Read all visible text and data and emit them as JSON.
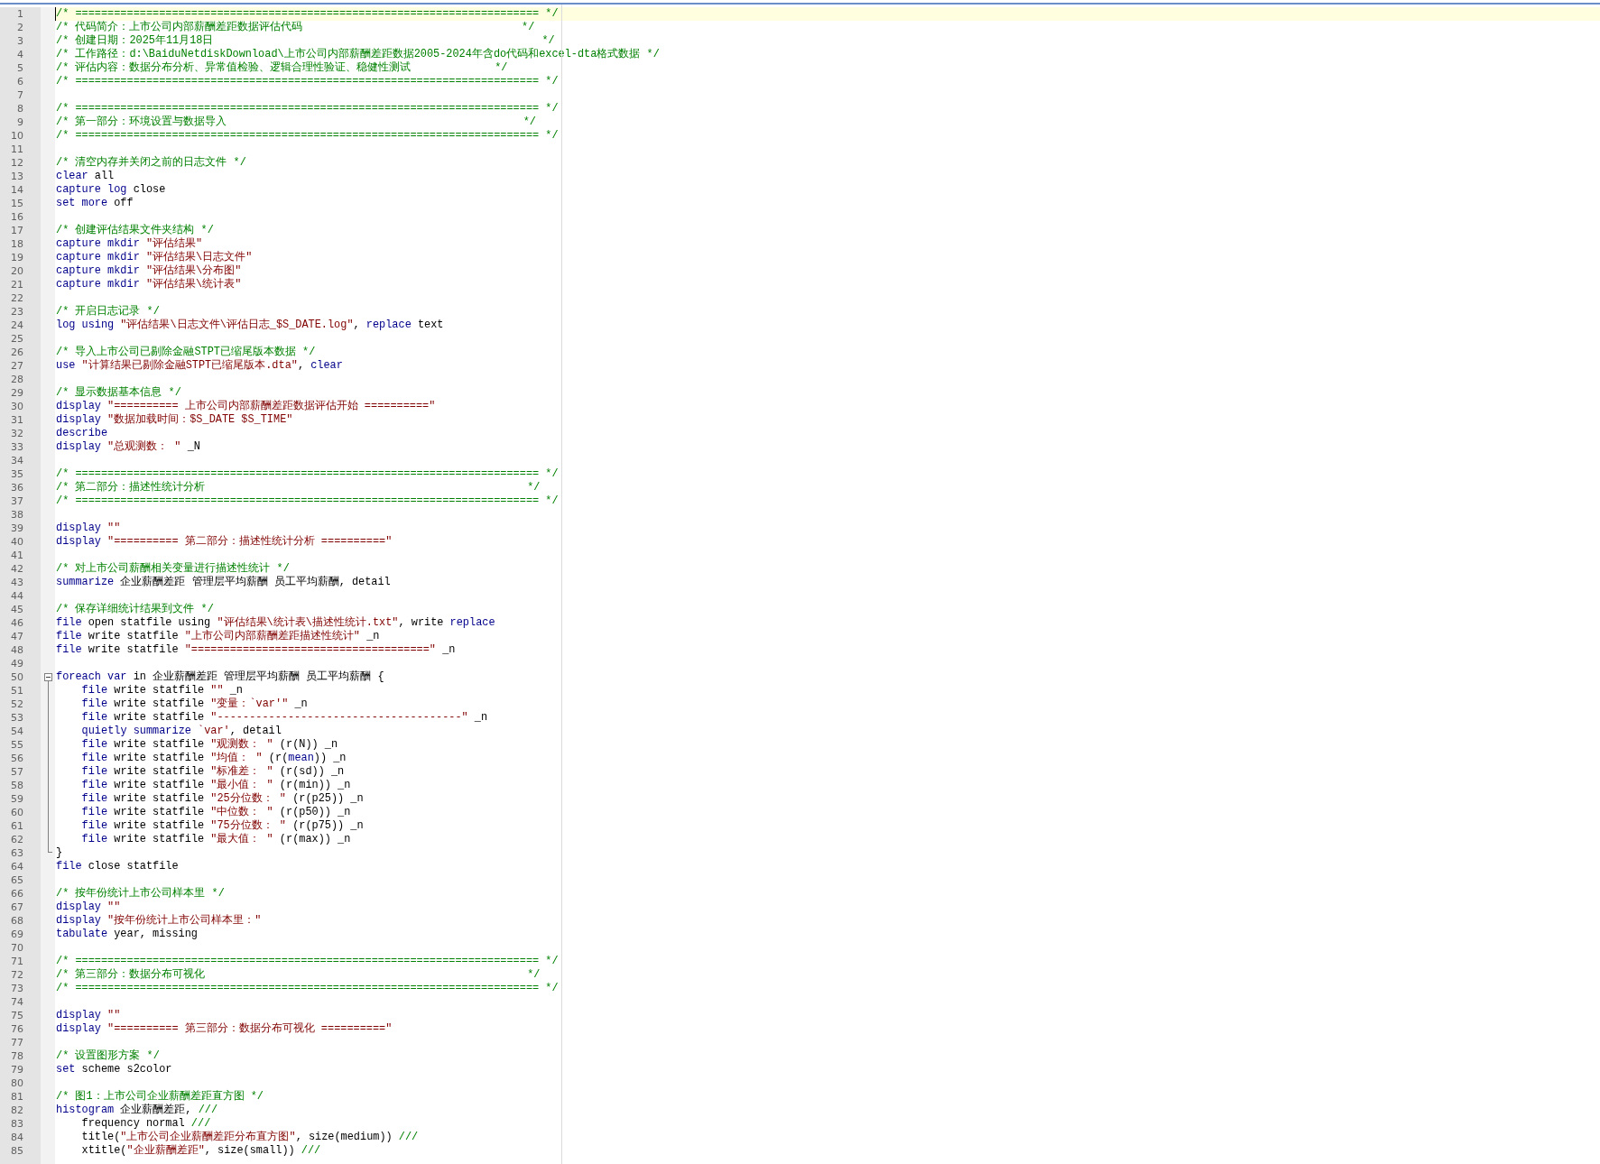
{
  "lines": [
    {
      "number": "1",
      "current": true,
      "segments": [
        {
          "kind": "comment",
          "text": "/* ======================================================================== */"
        }
      ]
    },
    {
      "number": "2",
      "current": false,
      "segments": [
        {
          "kind": "comment",
          "text": "/* 代码简介：上市公司内部薪酬差距数据评估代码                                  */"
        }
      ]
    },
    {
      "number": "3",
      "current": false,
      "segments": [
        {
          "kind": "comment",
          "text": "/* 创建日期：2025年11月18日                                                   */"
        }
      ]
    },
    {
      "number": "4",
      "current": false,
      "segments": [
        {
          "kind": "comment",
          "text": "/* 工作路径：d:\\BaiduNetdiskDownload\\上市公司内部薪酬差距数据2005-2024年含do代码和excel-dta格式数据 */"
        }
      ]
    },
    {
      "number": "5",
      "current": false,
      "segments": [
        {
          "kind": "comment",
          "text": "/* 评估内容：数据分布分析、异常值检验、逻辑合理性验证、稳健性测试             */"
        }
      ]
    },
    {
      "number": "6",
      "current": false,
      "segments": [
        {
          "kind": "comment",
          "text": "/* ======================================================================== */"
        }
      ]
    },
    {
      "number": "7",
      "current": false
    },
    {
      "number": "8",
      "current": false,
      "segments": [
        {
          "kind": "comment",
          "text": "/* ======================================================================== */"
        }
      ]
    },
    {
      "number": "9",
      "current": false,
      "segments": [
        {
          "kind": "comment",
          "text": "/* 第一部分：环境设置与数据导入                                              */"
        }
      ]
    },
    {
      "number": "10",
      "current": false,
      "segments": [
        {
          "kind": "comment",
          "text": "/* ======================================================================== */"
        }
      ]
    },
    {
      "number": "11",
      "current": false
    },
    {
      "number": "12",
      "current": false,
      "segments": [
        {
          "kind": "comment",
          "text": "/* 清空内存并关闭之前的日志文件 */"
        }
      ]
    },
    {
      "number": "13",
      "current": false,
      "segments": [
        {
          "kind": "keyword",
          "text": "clear"
        },
        {
          "kind": "plain",
          "text": " all"
        }
      ]
    },
    {
      "number": "14",
      "current": false,
      "segments": [
        {
          "kind": "keyword",
          "text": "capture log"
        },
        {
          "kind": "plain",
          "text": " close"
        }
      ]
    },
    {
      "number": "15",
      "current": false,
      "segments": [
        {
          "kind": "keyword",
          "text": "set more"
        },
        {
          "kind": "plain",
          "text": " off"
        }
      ]
    },
    {
      "number": "16",
      "current": false
    },
    {
      "number": "17",
      "current": false,
      "segments": [
        {
          "kind": "comment",
          "text": "/* 创建评估结果文件夹结构 */"
        }
      ]
    },
    {
      "number": "18",
      "current": false,
      "segments": [
        {
          "kind": "keyword",
          "text": "capture mkdir "
        },
        {
          "kind": "string",
          "text": "\"评估结果\""
        }
      ]
    },
    {
      "number": "19",
      "current": false,
      "segments": [
        {
          "kind": "keyword",
          "text": "capture mkdir "
        },
        {
          "kind": "string",
          "text": "\"评估结果\\日志文件\""
        }
      ]
    },
    {
      "number": "20",
      "current": false,
      "segments": [
        {
          "kind": "keyword",
          "text": "capture mkdir "
        },
        {
          "kind": "string",
          "text": "\"评估结果\\分布图\""
        }
      ]
    },
    {
      "number": "21",
      "current": false,
      "segments": [
        {
          "kind": "keyword",
          "text": "capture mkdir "
        },
        {
          "kind": "string",
          "text": "\"评估结果\\统计表\""
        }
      ]
    },
    {
      "number": "22",
      "current": false
    },
    {
      "number": "23",
      "current": false,
      "segments": [
        {
          "kind": "comment",
          "text": "/* 开启日志记录 */"
        }
      ]
    },
    {
      "number": "24",
      "current": false,
      "segments": [
        {
          "kind": "keyword",
          "text": "log using "
        },
        {
          "kind": "string",
          "text": "\"评估结果\\日志文件\\评估日志_$S_DATE.log\""
        },
        {
          "kind": "plain",
          "text": ", "
        },
        {
          "kind": "keyword",
          "text": "replace"
        },
        {
          "kind": "plain",
          "text": " text"
        }
      ]
    },
    {
      "number": "25",
      "current": false
    },
    {
      "number": "26",
      "current": false,
      "segments": [
        {
          "kind": "comment",
          "text": "/* 导入上市公司已剔除金融STPT已缩尾版本数据 */"
        }
      ]
    },
    {
      "number": "27",
      "current": false,
      "segments": [
        {
          "kind": "keyword",
          "text": "use "
        },
        {
          "kind": "string",
          "text": "\"计算结果已剔除金融STPT已缩尾版本.dta\""
        },
        {
          "kind": "plain",
          "text": ", "
        },
        {
          "kind": "keyword",
          "text": "clear"
        }
      ]
    },
    {
      "number": "28",
      "current": false
    },
    {
      "number": "29",
      "current": false,
      "segments": [
        {
          "kind": "comment",
          "text": "/* 显示数据基本信息 */"
        }
      ]
    },
    {
      "number": "30",
      "current": false,
      "segments": [
        {
          "kind": "keyword",
          "text": "display "
        },
        {
          "kind": "string",
          "text": "\"========== 上市公司内部薪酬差距数据评估开始 ==========\""
        }
      ]
    },
    {
      "number": "31",
      "current": false,
      "segments": [
        {
          "kind": "keyword",
          "text": "display "
        },
        {
          "kind": "string",
          "text": "\"数据加载时间：$S_DATE $S_TIME\""
        }
      ]
    },
    {
      "number": "32",
      "current": false,
      "segments": [
        {
          "kind": "keyword",
          "text": "describe"
        }
      ]
    },
    {
      "number": "33",
      "current": false,
      "segments": [
        {
          "kind": "keyword",
          "text": "display "
        },
        {
          "kind": "string",
          "text": "\"总观测数： \""
        },
        {
          "kind": "plain",
          "text": " _N"
        }
      ]
    },
    {
      "number": "34",
      "current": false
    },
    {
      "number": "35",
      "current": false,
      "segments": [
        {
          "kind": "comment",
          "text": "/* ======================================================================== */"
        }
      ]
    },
    {
      "number": "36",
      "current": false,
      "segments": [
        {
          "kind": "comment",
          "text": "/* 第二部分：描述性统计分析                                                  */"
        }
      ]
    },
    {
      "number": "37",
      "current": false,
      "segments": [
        {
          "kind": "comment",
          "text": "/* ======================================================================== */"
        }
      ]
    },
    {
      "number": "38",
      "current": false
    },
    {
      "number": "39",
      "current": false,
      "segments": [
        {
          "kind": "keyword",
          "text": "display "
        },
        {
          "kind": "string",
          "text": "\"\""
        }
      ]
    },
    {
      "number": "40",
      "current": false,
      "segments": [
        {
          "kind": "keyword",
          "text": "display "
        },
        {
          "kind": "string",
          "text": "\"========== 第二部分：描述性统计分析 ==========\""
        }
      ]
    },
    {
      "number": "41",
      "current": false
    },
    {
      "number": "42",
      "current": false,
      "segments": [
        {
          "kind": "comment",
          "text": "/* 对上市公司薪酬相关变量进行描述性统计 */"
        }
      ]
    },
    {
      "number": "43",
      "current": false,
      "segments": [
        {
          "kind": "keyword",
          "text": "summarize"
        },
        {
          "kind": "plain",
          "text": " 企业薪酬差距 管理层平均薪酬 员工平均薪酬, detail"
        }
      ]
    },
    {
      "number": "44",
      "current": false
    },
    {
      "number": "45",
      "current": false,
      "segments": [
        {
          "kind": "comment",
          "text": "/* 保存详细统计结果到文件 */"
        }
      ]
    },
    {
      "number": "46",
      "current": false,
      "segments": [
        {
          "kind": "keyword",
          "text": "file"
        },
        {
          "kind": "plain",
          "text": " open statfile using "
        },
        {
          "kind": "string",
          "text": "\"评估结果\\统计表\\描述性统计.txt\""
        },
        {
          "kind": "plain",
          "text": ", write "
        },
        {
          "kind": "keyword",
          "text": "replace"
        }
      ]
    },
    {
      "number": "47",
      "current": false,
      "segments": [
        {
          "kind": "keyword",
          "text": "file"
        },
        {
          "kind": "plain",
          "text": " write statfile "
        },
        {
          "kind": "string",
          "text": "\"上市公司内部薪酬差距描述性统计\""
        },
        {
          "kind": "plain",
          "text": " _n"
        }
      ]
    },
    {
      "number": "48",
      "current": false,
      "segments": [
        {
          "kind": "keyword",
          "text": "file"
        },
        {
          "kind": "plain",
          "text": " write statfile "
        },
        {
          "kind": "string",
          "text": "\"=====================================\""
        },
        {
          "kind": "plain",
          "text": " _n"
        }
      ]
    },
    {
      "number": "49",
      "current": false
    },
    {
      "number": "50",
      "current": false,
      "expanded": true,
      "segments": [
        {
          "kind": "keyword",
          "text": "foreach var"
        },
        {
          "kind": "plain",
          "text": " in 企业薪酬差距 管理层平均薪酬 员工平均薪酬 {"
        }
      ],
      "children": [
        {
          "number": "51",
          "current": false,
          "segments": [
            {
              "kind": "keyword",
              "text": "file"
            },
            {
              "kind": "plain",
              "text": " write statfile "
            },
            {
              "kind": "string",
              "text": "\"\""
            },
            {
              "kind": "plain",
              "text": " _n"
            }
          ]
        },
        {
          "number": "52",
          "current": false,
          "segments": [
            {
              "kind": "keyword",
              "text": "file"
            },
            {
              "kind": "plain",
              "text": " write statfile "
            },
            {
              "kind": "string",
              "text": "\"变量：`var'\""
            },
            {
              "kind": "plain",
              "text": " _n"
            }
          ]
        },
        {
          "number": "53",
          "current": false,
          "segments": [
            {
              "kind": "keyword",
              "text": "file"
            },
            {
              "kind": "plain",
              "text": " write statfile "
            },
            {
              "kind": "string",
              "text": "\"--------------------------------------\""
            },
            {
              "kind": "plain",
              "text": " _n"
            }
          ]
        },
        {
          "number": "54",
          "current": false,
          "segments": [
            {
              "kind": "keyword",
              "text": "quietly summarize "
            },
            {
              "kind": "string",
              "text": "`var'"
            },
            {
              "kind": "plain",
              "text": ", detail"
            }
          ]
        },
        {
          "number": "55",
          "current": false,
          "segments": [
            {
              "kind": "keyword",
              "text": "file"
            },
            {
              "kind": "plain",
              "text": " write statfile "
            },
            {
              "kind": "string",
              "text": "\"观测数： \""
            },
            {
              "kind": "plain",
              "text": " (r(N)) _n"
            }
          ]
        },
        {
          "number": "56",
          "current": false,
          "segments": [
            {
              "kind": "keyword",
              "text": "file"
            },
            {
              "kind": "plain",
              "text": " write statfile "
            },
            {
              "kind": "string",
              "text": "\"均值： \""
            },
            {
              "kind": "plain",
              "text": " (r("
            },
            {
              "kind": "keyword",
              "text": "mean"
            },
            {
              "kind": "plain",
              "text": ")) _n"
            }
          ]
        },
        {
          "number": "57",
          "current": false,
          "segments": [
            {
              "kind": "keyword",
              "text": "file"
            },
            {
              "kind": "plain",
              "text": " write statfile "
            },
            {
              "kind": "string",
              "text": "\"标准差： \""
            },
            {
              "kind": "plain",
              "text": " (r(sd)) _n"
            }
          ]
        },
        {
          "number": "58",
          "current": false,
          "segments": [
            {
              "kind": "keyword",
              "text": "file"
            },
            {
              "kind": "plain",
              "text": " write statfile "
            },
            {
              "kind": "string",
              "text": "\"最小值： \""
            },
            {
              "kind": "plain",
              "text": " (r(min)) _n"
            }
          ]
        },
        {
          "number": "59",
          "current": false,
          "segments": [
            {
              "kind": "keyword",
              "text": "file"
            },
            {
              "kind": "plain",
              "text": " write statfile "
            },
            {
              "kind": "string",
              "text": "\"25分位数： \""
            },
            {
              "kind": "plain",
              "text": " (r(p25)) _n"
            }
          ]
        },
        {
          "number": "60",
          "current": false,
          "segments": [
            {
              "kind": "keyword",
              "text": "file"
            },
            {
              "kind": "plain",
              "text": " write statfile "
            },
            {
              "kind": "string",
              "text": "\"中位数： \""
            },
            {
              "kind": "plain",
              "text": " (r(p50)) _n"
            }
          ]
        },
        {
          "number": "61",
          "current": false,
          "segments": [
            {
              "kind": "keyword",
              "text": "file"
            },
            {
              "kind": "plain",
              "text": " write statfile "
            },
            {
              "kind": "string",
              "text": "\"75分位数： \""
            },
            {
              "kind": "plain",
              "text": " (r(p75)) _n"
            }
          ]
        },
        {
          "number": "62",
          "current": false,
          "segments": [
            {
              "kind": "keyword",
              "text": "file"
            },
            {
              "kind": "plain",
              "text": " write statfile "
            },
            {
              "kind": "string",
              "text": "\"最大值： \""
            },
            {
              "kind": "plain",
              "text": " (r(max)) _n"
            }
          ]
        }
      ]
    },
    {
      "number": "63",
      "current": false,
      "segments": [
        {
          "kind": "plain",
          "text": "}"
        }
      ]
    },
    {
      "number": "64",
      "current": false,
      "segments": [
        {
          "kind": "keyword",
          "text": "file"
        },
        {
          "kind": "plain",
          "text": " close statfile"
        }
      ]
    },
    {
      "number": "65",
      "current": false
    },
    {
      "number": "66",
      "current": false,
      "segments": [
        {
          "kind": "comment",
          "text": "/* 按年份统计上市公司样本里 */"
        }
      ]
    },
    {
      "number": "67",
      "current": false,
      "segments": [
        {
          "kind": "keyword",
          "text": "display "
        },
        {
          "kind": "string",
          "text": "\"\""
        }
      ]
    },
    {
      "number": "68",
      "current": false,
      "segments": [
        {
          "kind": "keyword",
          "text": "display "
        },
        {
          "kind": "string",
          "text": "\"按年份统计上市公司样本里：\""
        }
      ]
    },
    {
      "number": "69",
      "current": false,
      "segments": [
        {
          "kind": "keyword",
          "text": "tabulate"
        },
        {
          "kind": "plain",
          "text": " year, missing"
        }
      ]
    },
    {
      "number": "70",
      "current": false
    },
    {
      "number": "71",
      "current": false,
      "segments": [
        {
          "kind": "comment",
          "text": "/* ======================================================================== */"
        }
      ]
    },
    {
      "number": "72",
      "current": false,
      "segments": [
        {
          "kind": "comment",
          "text": "/* 第三部分：数据分布可视化                                                  */"
        }
      ]
    },
    {
      "number": "73",
      "current": false,
      "segments": [
        {
          "kind": "comment",
          "text": "/* ======================================================================== */"
        }
      ]
    },
    {
      "number": "74",
      "current": false
    },
    {
      "number": "75",
      "current": false,
      "segments": [
        {
          "kind": "keyword",
          "text": "display "
        },
        {
          "kind": "string",
          "text": "\"\""
        }
      ]
    },
    {
      "number": "76",
      "current": false,
      "segments": [
        {
          "kind": "keyword",
          "text": "display "
        },
        {
          "kind": "string",
          "text": "\"========== 第三部分：数据分布可视化 ==========\""
        }
      ]
    },
    {
      "number": "77",
      "current": false
    },
    {
      "number": "78",
      "current": false,
      "segments": [
        {
          "kind": "comment",
          "text": "/* 设置图形方案 */"
        }
      ]
    },
    {
      "number": "79",
      "current": false,
      "segments": [
        {
          "kind": "keyword",
          "text": "set"
        },
        {
          "kind": "plain",
          "text": " scheme s2color"
        }
      ]
    },
    {
      "number": "80",
      "current": false
    },
    {
      "number": "81",
      "current": false,
      "segments": [
        {
          "kind": "comment",
          "text": "/* 图1：上市公司企业薪酬差距直方图 */"
        }
      ]
    },
    {
      "number": "82",
      "current": false,
      "segments": [
        {
          "kind": "keyword",
          "text": "histogram"
        },
        {
          "kind": "plain",
          "text": " 企业薪酬差距, "
        },
        {
          "kind": "comment",
          "text": "///"
        }
      ]
    },
    {
      "number": "83",
      "current": false,
      "segments": [
        {
          "kind": "plain",
          "text": "    frequency normal "
        },
        {
          "kind": "comment",
          "text": "///"
        }
      ]
    },
    {
      "number": "84",
      "current": false,
      "segments": [
        {
          "kind": "plain",
          "text": "    title("
        },
        {
          "kind": "string",
          "text": "\"上市公司企业薪酬差距分布直方图\""
        },
        {
          "kind": "plain",
          "text": ", size(medium)) "
        },
        {
          "kind": "comment",
          "text": "///"
        }
      ]
    },
    {
      "number": "85",
      "current": false,
      "segments": [
        {
          "kind": "plain",
          "text": "    xtitle("
        },
        {
          "kind": "string",
          "text": "\"企业薪酬差距\""
        },
        {
          "kind": "plain",
          "text": ", size(small)) "
        },
        {
          "kind": "comment",
          "text": "///"
        }
      ]
    }
  ]
}
